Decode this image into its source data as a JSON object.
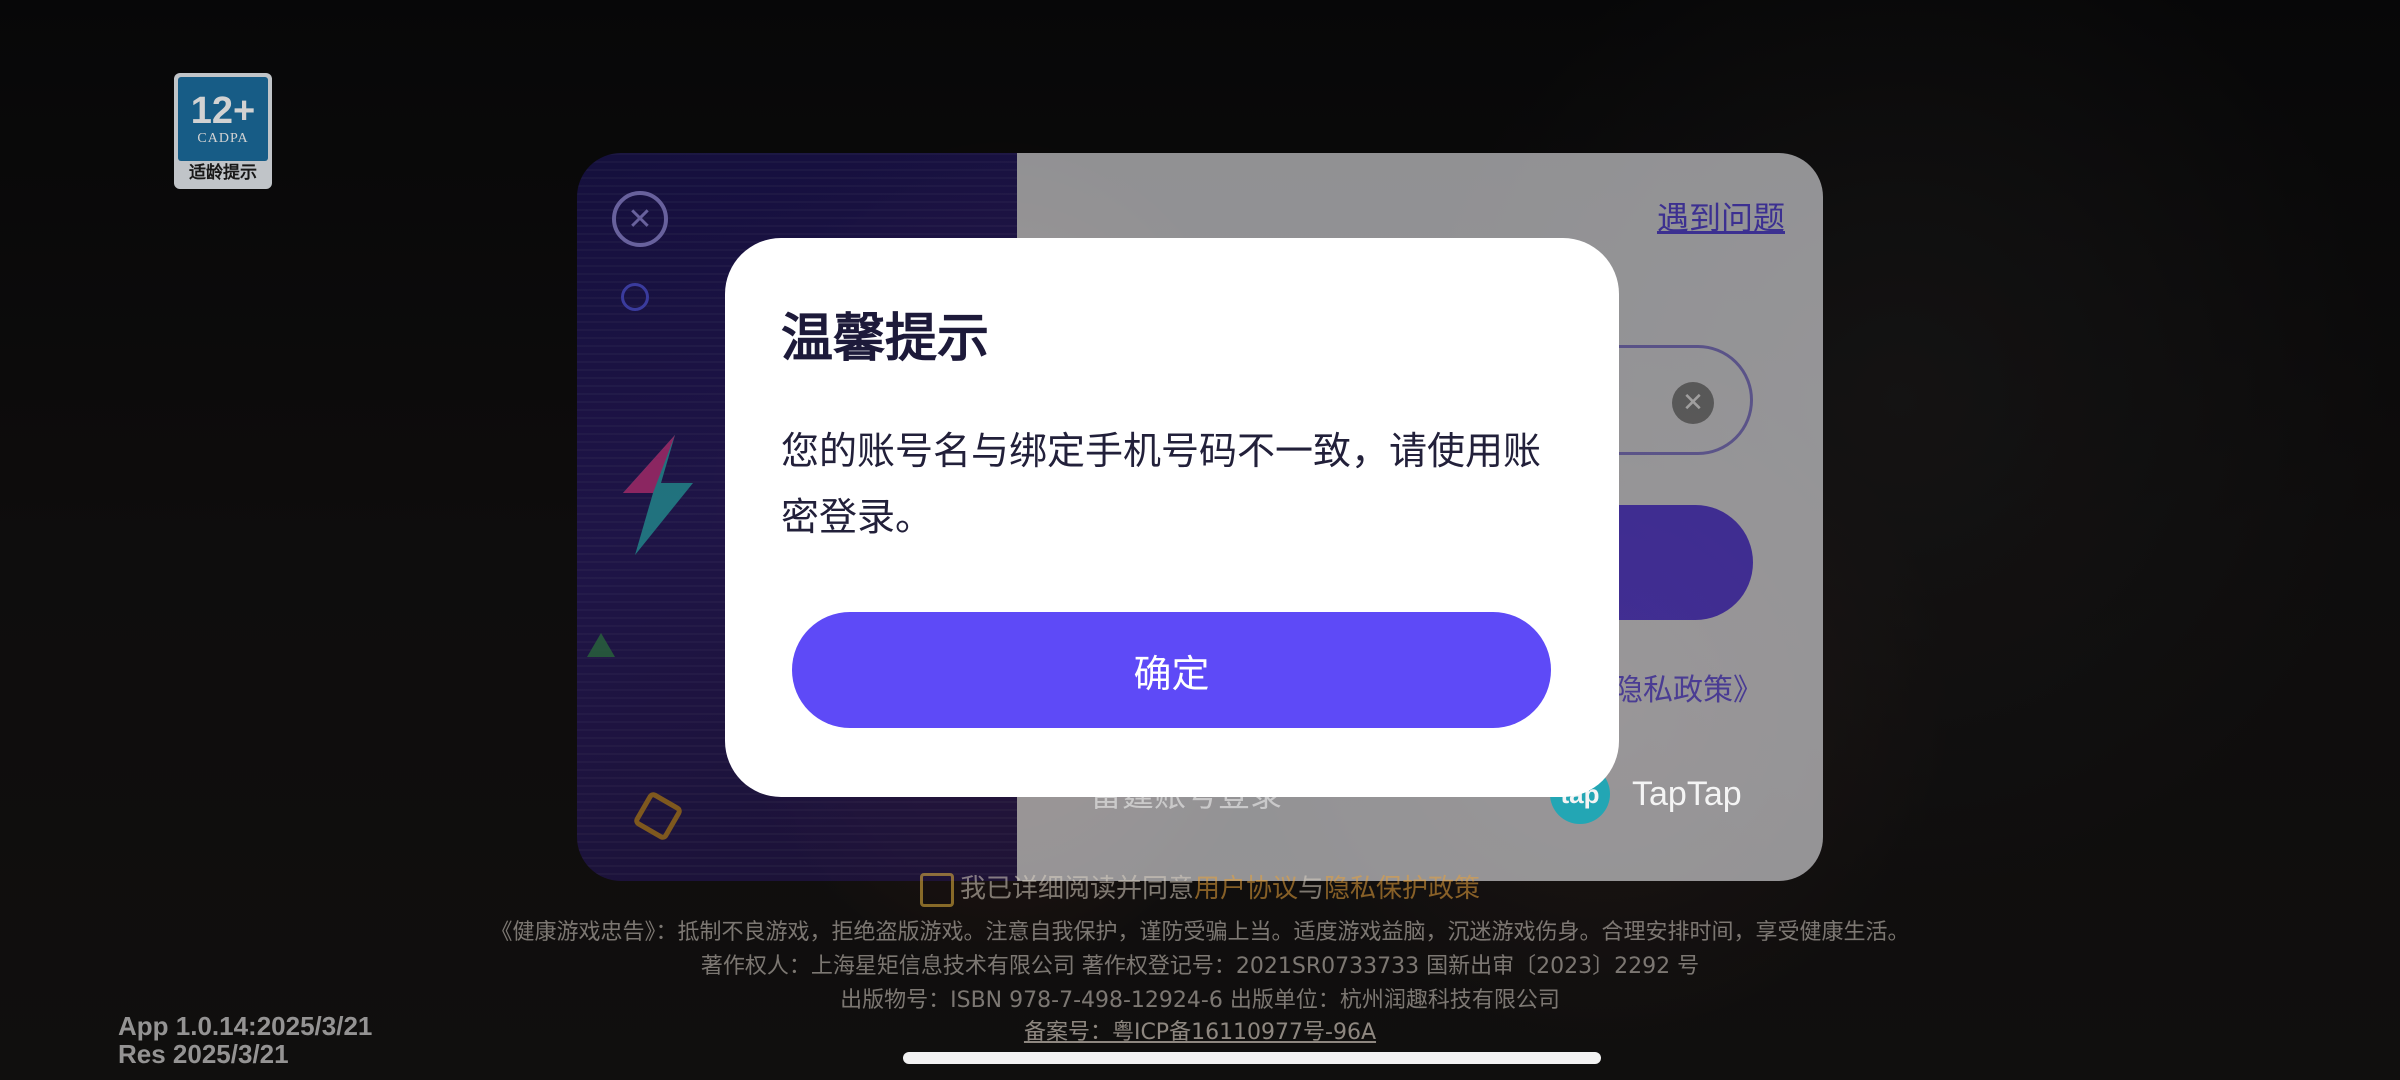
{
  "age_rating": {
    "number": "12+",
    "org": "CADPA",
    "label": "适龄提示"
  },
  "login_panel": {
    "help_link": "遇到问题",
    "privacy_link": "隐私政策》",
    "alt_login_label": "TapTap",
    "fast_login_label": "雷霆账号登录",
    "colors": {
      "accent": "#5e4af7",
      "panel_bg": "#ececf0"
    }
  },
  "dialog": {
    "title": "温馨提示",
    "message": "您的账号名与绑定手机号码不一致，请使用账密登录。",
    "confirm_label": "确定"
  },
  "agreement": {
    "prefix": "我已详细阅读并同意",
    "user_agreement": "用户协议",
    "conjunction": "与",
    "privacy_policy": "隐私保护政策"
  },
  "footer": {
    "health_notice": "《健康游戏忠告》：抵制不良游戏，拒绝盗版游戏。注意自我保护，谨防受骗上当。适度游戏益脑，沉迷游戏伤身。合理安排时间，享受健康生活。",
    "copyright": "著作权人：上海星矩信息技术有限公司    著作权登记号：2021SR0733733    国新出审〔2023〕2292 号",
    "publication": "出版物号：ISBN 978-7-498-12924-6    出版单位：杭州润趣科技有限公司",
    "icp": "备案号：粤ICP备16110977号-96A"
  },
  "version": {
    "app": "App 1.0.14:2025/3/21",
    "res": "Res 2025/3/21"
  }
}
